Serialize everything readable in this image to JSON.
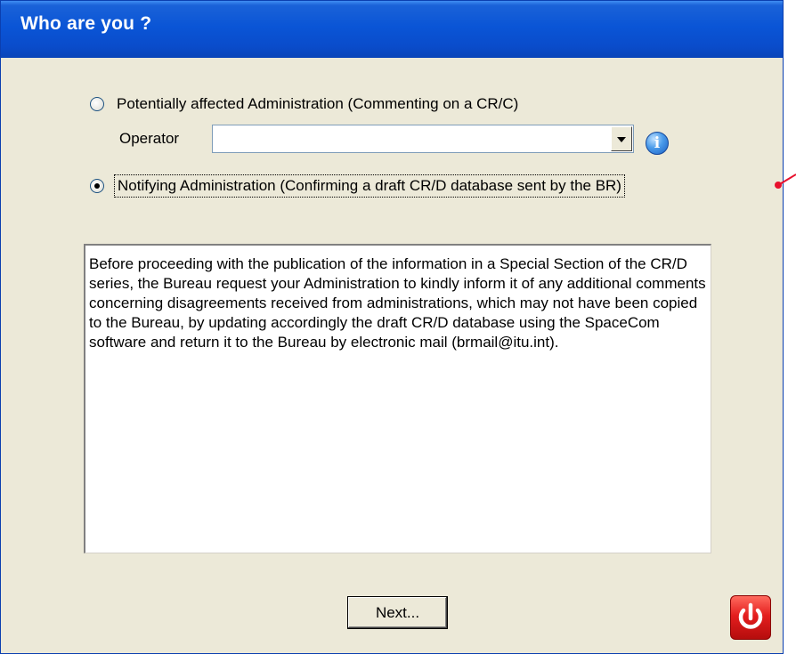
{
  "window": {
    "title": "Who are you ?"
  },
  "options": {
    "potentially_affected": {
      "label": "Potentially affected Administration (Commenting on a CR/C)",
      "selected": false
    },
    "notifying": {
      "label": "Notifying Administration (Confirming a draft CR/D database sent by the BR)",
      "selected": true
    }
  },
  "operator": {
    "label": "Operator",
    "value": ""
  },
  "description": {
    "text": "Before proceeding with the publication of the information in a Special Section of the CR/D series, the Bureau request your Administration to kindly inform it of any additional comments concerning disagreements received from administrations, which may not have been copied to the Bureau, by updating accordingly the draft CR/D database using the SpaceCom software and return it to the Bureau by electronic mail (brmail@itu.int)."
  },
  "buttons": {
    "next_label": "Next..."
  },
  "icons": {
    "info": "info-icon",
    "power": "power-icon",
    "dropdown": "chevron-down-icon"
  },
  "colors": {
    "titlebar": "#0a55d6",
    "window_bg": "#ece9d8",
    "annotation": "#e8112d",
    "power_button": "#e41e1e"
  }
}
